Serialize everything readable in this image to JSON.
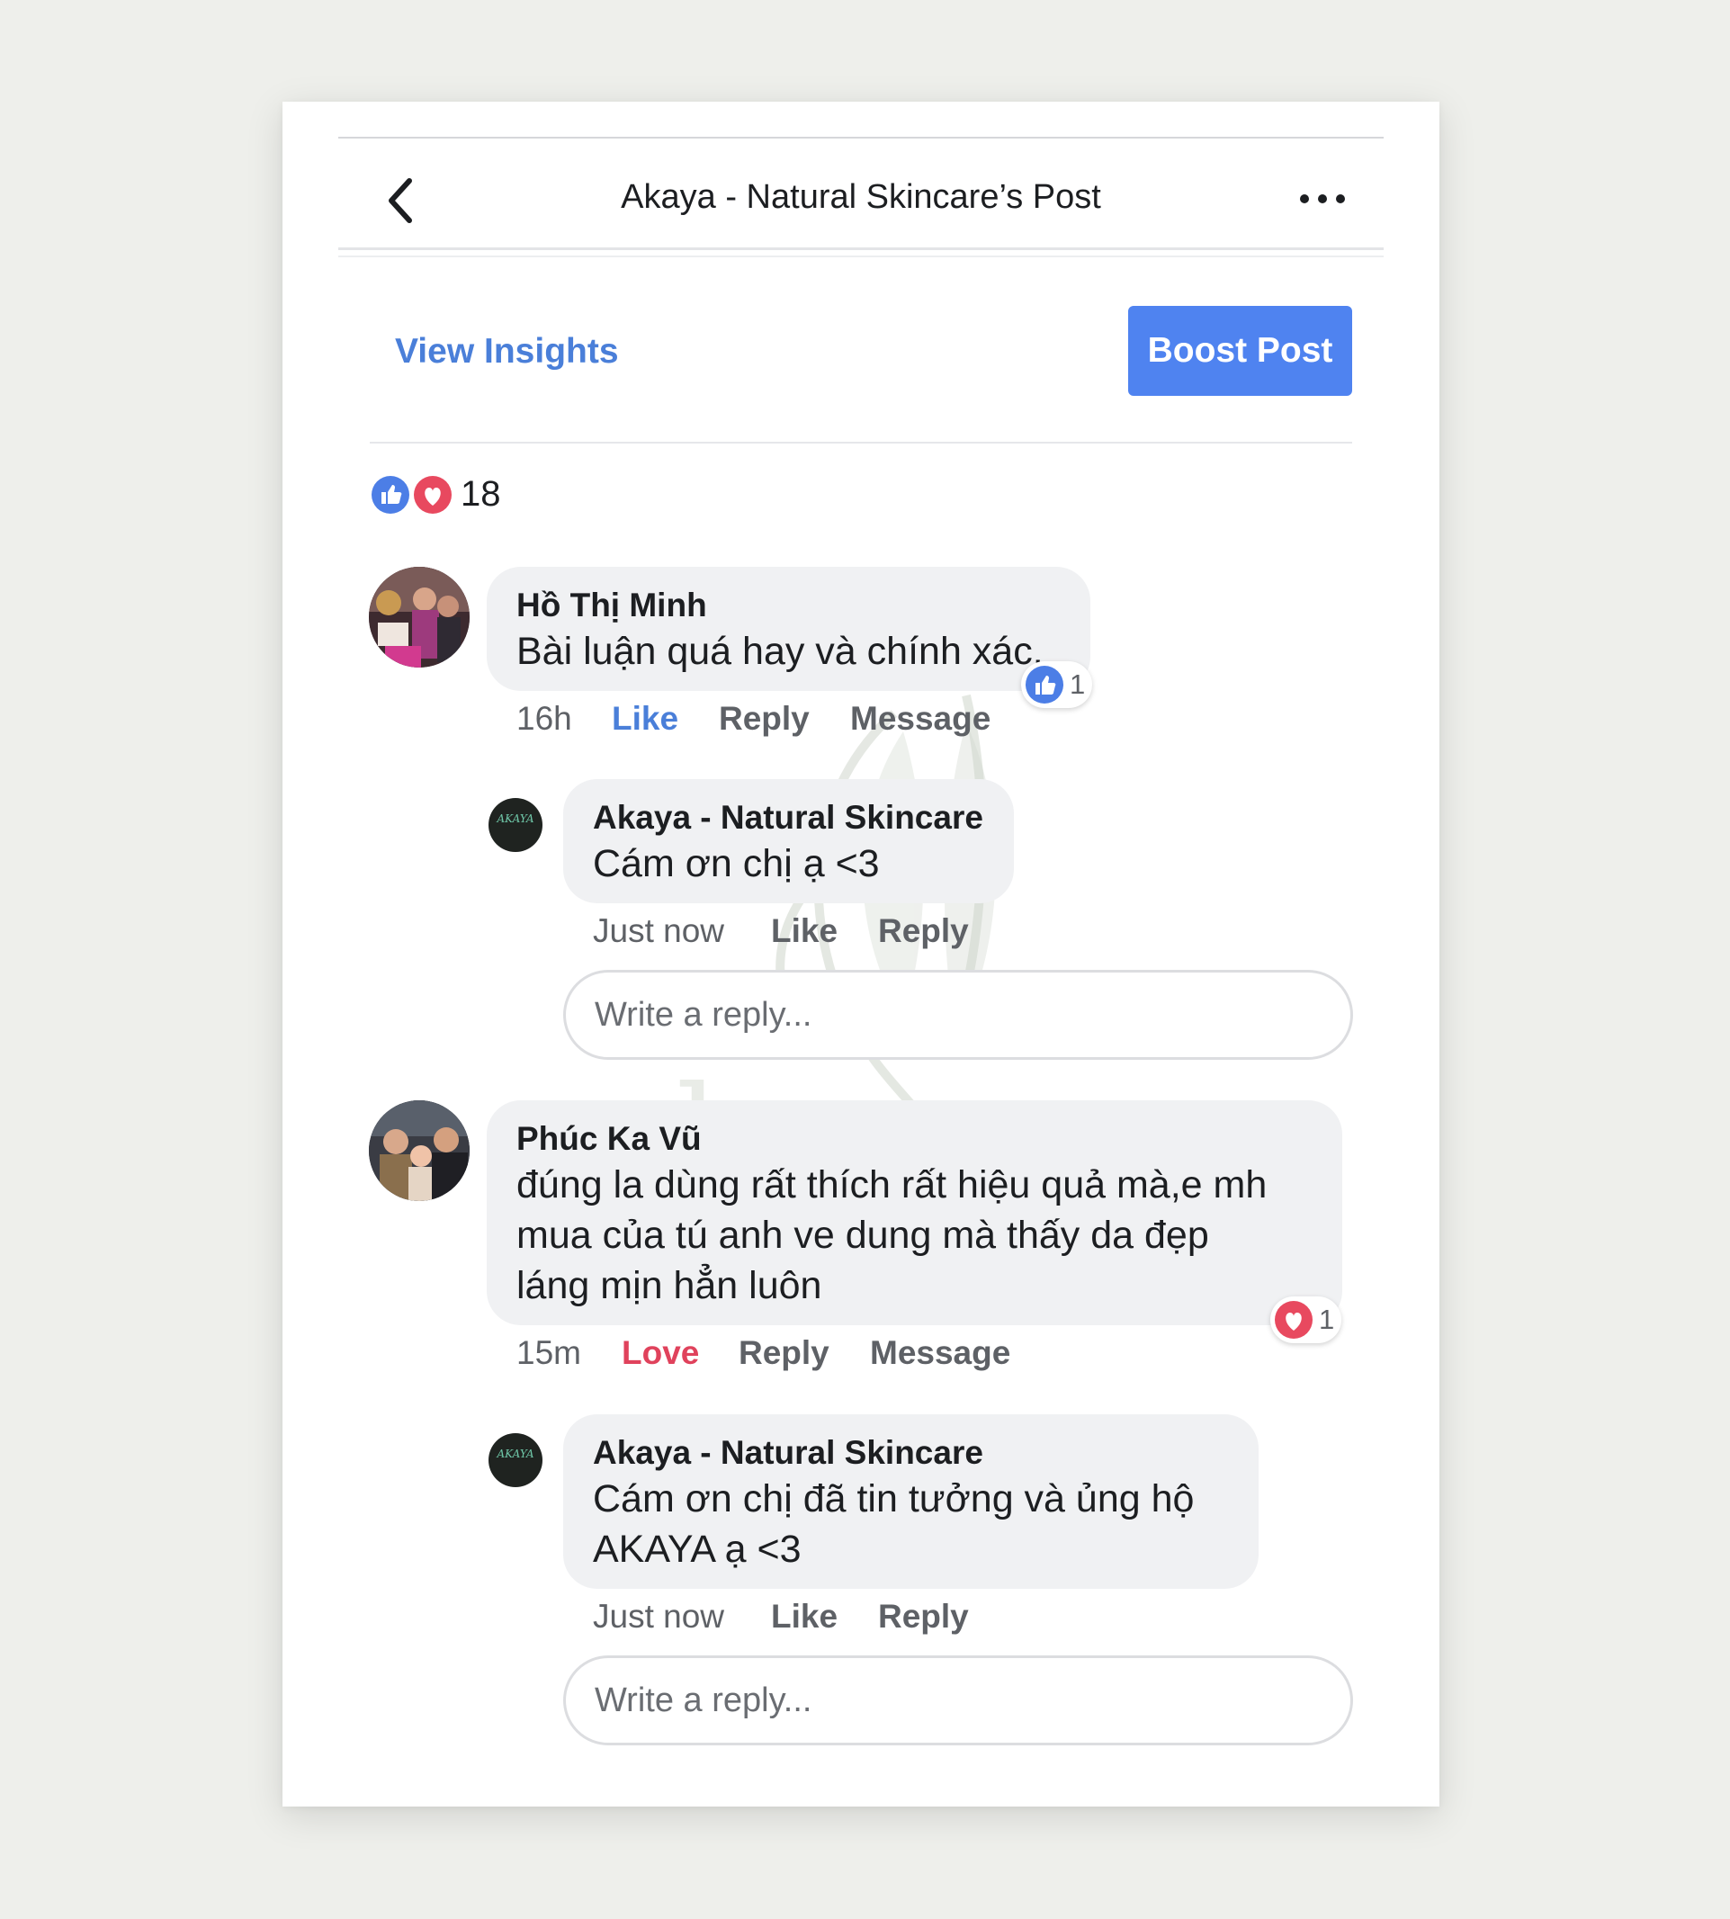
{
  "header": {
    "title": "Akaya - Natural Skincare’s Post"
  },
  "actions": {
    "view_insights": "View Insights",
    "boost_post": "Boost Post"
  },
  "reactions": {
    "count": "18"
  },
  "comments": [
    {
      "author": "Hồ Thị Minh",
      "text": "Bài luận quá hay và chính xác.",
      "time": "16h",
      "reaction_action": "Like",
      "reply": "Reply",
      "message": "Message",
      "reaction_count": "1",
      "page_reply": {
        "author": "Akaya - Natural Skincare",
        "text": "Cám ơn chị ạ <3",
        "time": "Just now",
        "like": "Like",
        "reply": "Reply"
      },
      "reply_placeholder": "Write a reply..."
    },
    {
      "author": "Phúc Ka Vũ",
      "text_lines": [
        "đúng la dùng rất thích rất hiệu quả mà,e mh",
        "mua của tú anh ve dung mà thấy da đẹp",
        "láng mịn hẳn luôn"
      ],
      "time": "15m",
      "reaction_action": "Love",
      "reply": "Reply",
      "message": "Message",
      "reaction_count": "1",
      "page_reply": {
        "author": "Akaya - Natural Skincare",
        "text_lines": [
          "Cám ơn chị đã tin tưởng và ủng hộ",
          "AKAYA ạ <3"
        ],
        "time": "Just now",
        "like": "Like",
        "reply": "Reply"
      },
      "reply_placeholder": "Write a reply..."
    }
  ],
  "logo_text": "AKAYA",
  "watermark": {
    "brand": "akaya",
    "tagline": "natural skincare"
  },
  "colors": {
    "accent": "#4f83f0",
    "link": "#4a7fd9",
    "love": "#e0425c",
    "bubble": "#f0f1f3"
  }
}
